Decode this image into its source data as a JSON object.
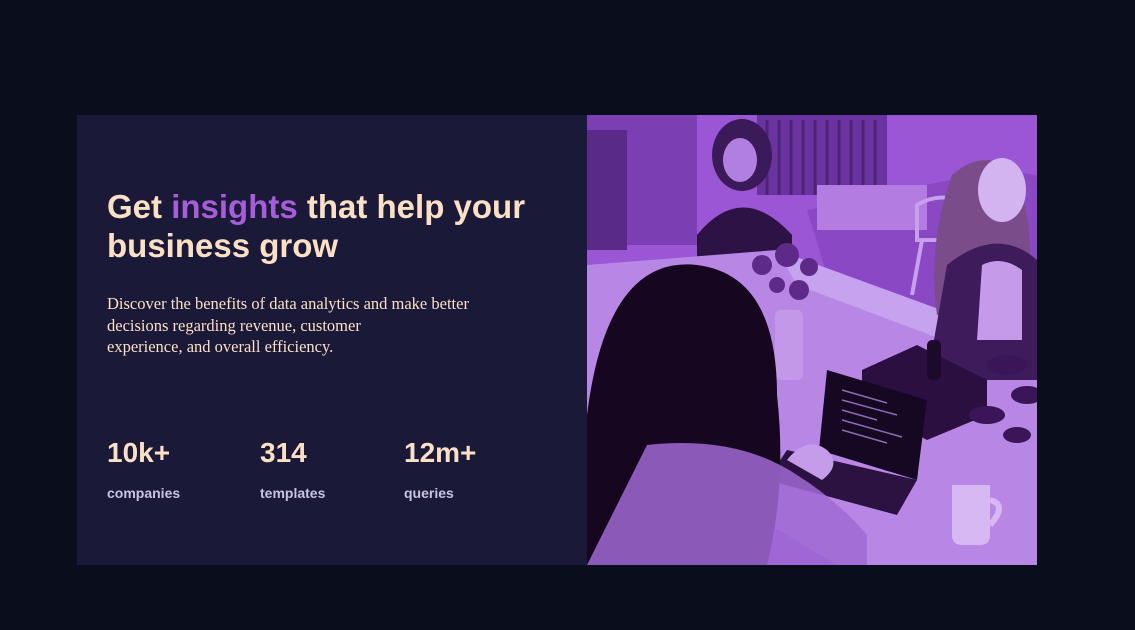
{
  "hero": {
    "title_before": "Get ",
    "title_accent": "insights",
    "title_after": " that help your business grow",
    "description_lines": [
      "Discover the benefits of data analytics and make better",
      "decisions regarding revenue, customer",
      "experience, and overall efficiency."
    ],
    "stats": [
      {
        "value": "10k+",
        "label": "companies"
      },
      {
        "value": "314",
        "label": "templates"
      },
      {
        "value": "12m+",
        "label": "queries"
      }
    ]
  },
  "image": {
    "subject": "women-working-at-office-table-photo",
    "overlay_color": "#9b55d6"
  },
  "colors": {
    "page_bg": "#0a0d1c",
    "card_bg": "#1b1938",
    "accent": "#a75dd9",
    "text": "#fbe0c6",
    "label": "#c9c3dd"
  }
}
